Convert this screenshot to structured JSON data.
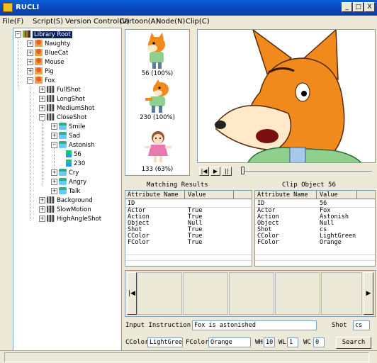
{
  "window": {
    "title": "RUCLI",
    "minimize": "_",
    "maximize": "□",
    "close": "X"
  },
  "menu": [
    "File(F)",
    "Script(S)",
    "Version Control(V)",
    "Cartoon(A)",
    "Node(N)",
    "Clip(C)"
  ],
  "tree": {
    "root": "Library Root",
    "characters": [
      "Naughty",
      "BlueCat",
      "Mouse",
      "Pig",
      "Fox"
    ],
    "shots": [
      "FullShot",
      "LongShot",
      "MediumShot",
      "CloseShot"
    ],
    "actions": [
      "Smile",
      "Sad",
      "Astonish"
    ],
    "clips": [
      "56",
      "230"
    ],
    "actions_after": [
      "Cry",
      "Angry",
      "Talk"
    ],
    "shots_after": [
      "Background",
      "SlowMotion",
      "HighAngleShot"
    ]
  },
  "thumbnails": [
    {
      "caption": "56 (100%)",
      "icon": "fox-character-icon"
    },
    {
      "caption": "230 (100%)",
      "icon": "fox-character-icon"
    },
    {
      "caption": "133 (63%)",
      "icon": "girl-character-icon"
    }
  ],
  "player": {
    "prev": "|◀",
    "play": "▶",
    "pause": "||"
  },
  "matching": {
    "title": "Matching Results",
    "columns": [
      "Attribute Name",
      "Value"
    ],
    "rows": [
      [
        "ID",
        ""
      ],
      [
        "Actor",
        "True"
      ],
      [
        "Action",
        "True"
      ],
      [
        "Object",
        "Null"
      ],
      [
        "Shot",
        "True"
      ],
      [
        "CColor",
        "True"
      ],
      [
        "FColor",
        "True"
      ]
    ]
  },
  "clip": {
    "title": "Clip Object 56",
    "columns": [
      "Attribute Name",
      "Value"
    ],
    "rows": [
      [
        "ID",
        "56"
      ],
      [
        "Actor",
        "Fox"
      ],
      [
        "Action",
        "Astonish"
      ],
      [
        "Object",
        "Null"
      ],
      [
        "Shot",
        "cs"
      ],
      [
        "CColor",
        "LightGreen"
      ],
      [
        "FColor",
        "Orange"
      ]
    ]
  },
  "strip": {
    "prev": "|◀",
    "next": "▶"
  },
  "form": {
    "instruction_label": "Input Instruction",
    "instruction_value": "Fox is astonished",
    "shot_label": "Shot",
    "shot_value": "cs",
    "ccolor_label": "CColor",
    "ccolor_value": "LightGreer",
    "fcolor_label": "FColor",
    "fcolor_value": "Orange",
    "wh_label": "WH",
    "wh_value": "10",
    "wl_label": "WL",
    "wl_value": "1",
    "wc_label": "WC",
    "wc_value": "0",
    "search_label": "Search"
  },
  "colors": {
    "titlebar": "#0a4fc8",
    "face": "#ece9d8",
    "border": "#7f9db9",
    "fox_orange": "#f08a1c"
  }
}
